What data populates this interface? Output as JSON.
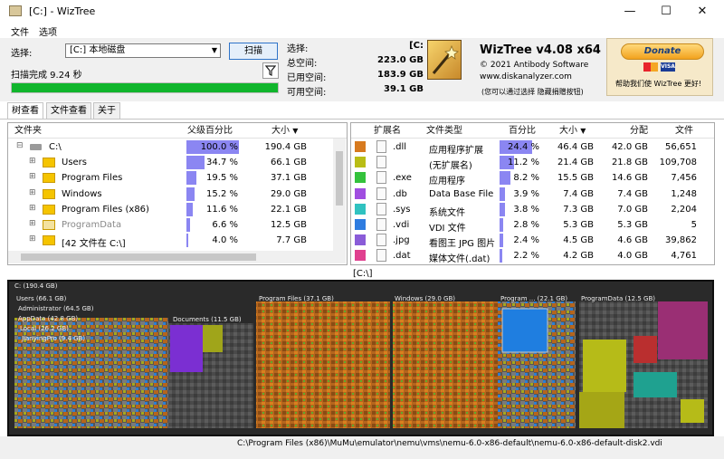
{
  "window": {
    "title": "[C:]  - WizTree",
    "min": "—",
    "max": "☐",
    "close": "✕"
  },
  "menu": [
    "文件",
    "选项"
  ],
  "scan": {
    "select_label": "选择:",
    "drive": "[C:] 本地磁盘",
    "scan_button": "扫描",
    "status": "扫描完成 9.24 秒",
    "progress": 1.0
  },
  "stats": {
    "select": {
      "label": "选择:",
      "value": "[C:"
    },
    "total": {
      "label": "总空间:",
      "value": "223.0 GB"
    },
    "used": {
      "label": "已用空间:",
      "value": "183.9 GB"
    },
    "free": {
      "label": "可用空间:",
      "value": "39.1 GB"
    }
  },
  "logo": {
    "title": "WizTree v4.08 x64",
    "copyright": "© 2021 Antibody Software",
    "site": "www.diskanalyzer.com",
    "note": "(您可以通过选择 隐藏捐赠按钮)"
  },
  "donate": {
    "button": "Donate",
    "text": "帮助我们使 WizTree 更好!"
  },
  "tabs": [
    "树查看",
    "文件查看",
    "关于"
  ],
  "tree": {
    "columns": {
      "folder": "文件夹",
      "pct": "父级百分比",
      "size": "大小"
    },
    "rows": [
      {
        "name": "C:\\",
        "pct_text": "100.0 %",
        "pct": 100.0,
        "size": "190.4 GB",
        "indent": 0,
        "expander": "⊟"
      },
      {
        "name": "Users",
        "pct_text": "34.7 %",
        "pct": 34.7,
        "size": "66.1 GB",
        "indent": 1,
        "expander": "⊞"
      },
      {
        "name": "Program Files",
        "pct_text": "19.5 %",
        "pct": 19.5,
        "size": "37.1 GB",
        "indent": 1,
        "expander": "⊞"
      },
      {
        "name": "Windows",
        "pct_text": "15.2 %",
        "pct": 15.2,
        "size": "29.0 GB",
        "indent": 1,
        "expander": "⊞"
      },
      {
        "name": "Program Files (x86)",
        "pct_text": "11.6 %",
        "pct": 11.6,
        "size": "22.1 GB",
        "indent": 1,
        "expander": "⊞"
      },
      {
        "name": "ProgramData",
        "pct_text": "6.6 %",
        "pct": 6.6,
        "size": "12.5 GB",
        "indent": 1,
        "expander": "⊞"
      },
      {
        "name": "[42 文件在 C:\\]",
        "pct_text": "4.0 %",
        "pct": 4.0,
        "size": "7.7 GB",
        "indent": 1,
        "expander": "⊞"
      }
    ]
  },
  "types": {
    "columns": {
      "ext": "扩展名",
      "type": "文件类型",
      "pct": "百分比",
      "size": "大小",
      "alloc": "分配",
      "files": "文件"
    },
    "rows": [
      {
        "color": "#d77a1f",
        "ext": ".dll",
        "type": "应用程序扩展",
        "pct_text": "24.4 %",
        "pct": 24.4,
        "size": "46.4 GB",
        "alloc": "42.0 GB",
        "files": "56,651"
      },
      {
        "color": "#b9bd16",
        "ext": "",
        "type": "(无扩展名)",
        "pct_text": "11.2 %",
        "pct": 11.2,
        "size": "21.4 GB",
        "alloc": "21.8 GB",
        "files": "109,708"
      },
      {
        "color": "#34c23c",
        "ext": ".exe",
        "type": "应用程序",
        "pct_text": "8.2 %",
        "pct": 8.2,
        "size": "15.5 GB",
        "alloc": "14.6 GB",
        "files": "7,456"
      },
      {
        "color": "#a04ee0",
        "ext": ".db",
        "type": "Data Base File",
        "pct_text": "3.9 %",
        "pct": 3.9,
        "size": "7.4 GB",
        "alloc": "7.4 GB",
        "files": "1,248"
      },
      {
        "color": "#30c2c0",
        "ext": ".sys",
        "type": "系统文件",
        "pct_text": "3.8 %",
        "pct": 3.8,
        "size": "7.3 GB",
        "alloc": "7.0 GB",
        "files": "2,204"
      },
      {
        "color": "#2e7ce0",
        "ext": ".vdi",
        "type": "VDI 文件",
        "pct_text": "2.8 %",
        "pct": 2.8,
        "size": "5.3 GB",
        "alloc": "5.3 GB",
        "files": "5"
      },
      {
        "color": "#8a5cd8",
        "ext": ".jpg",
        "type": "看图王 JPG 图片",
        "pct_text": "2.4 %",
        "pct": 2.4,
        "size": "4.5 GB",
        "alloc": "4.6 GB",
        "files": "39,862"
      },
      {
        "color": "#e0408f",
        "ext": ".dat",
        "type": "媒体文件(.dat)",
        "pct_text": "2.2 %",
        "pct": 2.2,
        "size": "4.2 GB",
        "alloc": "4.0 GB",
        "files": "4,761"
      }
    ]
  },
  "map": {
    "path": "[C:\\]",
    "root_label": "C: (190.4 GB)",
    "labels": {
      "users": "Users (66.1 GB)",
      "admin": "Administrator (64.5 GB)",
      "appdata": "AppData (42.8 GB)",
      "local": "Local (26.2 GB)",
      "jianying": "JianyingPro (9.4 GB)",
      "documents": "Documents (11.5 GB)",
      "progfiles": "Program Files (37.1 GB)",
      "windows": "Windows (29.0 GB)",
      "progx86": "Program ... (22.1 GB)",
      "progdata": "ProgramData (12.5 GB)"
    }
  },
  "status": {
    "path": "C:\\Program Files (x86)\\MuMu\\emulator\\nemu\\vms\\nemu-6.0-x86-default\\nemu-6.0-x86-default-disk2.vdi"
  },
  "colors": {
    "progress": "#10b52c",
    "pct_bar": "#8b86f2",
    "accent": "#2f74c9"
  }
}
